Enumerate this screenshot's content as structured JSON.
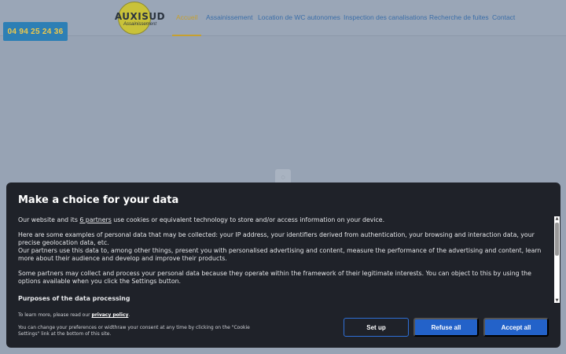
{
  "header": {
    "logo": {
      "name": "AUXISUD",
      "tagline": "Assainissement"
    },
    "nav": [
      {
        "label": "Accueil",
        "active": true
      },
      {
        "label": "Assainissement",
        "active": false
      },
      {
        "label": "Location de WC autonomes",
        "active": false
      },
      {
        "label": "Inspection des canalisations",
        "active": false
      },
      {
        "label": "Recherche de fuites",
        "active": false
      },
      {
        "label": "Contact",
        "active": false
      }
    ],
    "phone": "04 94 25 24 36",
    "colors": {
      "nav_link": "#3b6ea8",
      "nav_active": "#c7a02f",
      "phone_bg": "#2d7fb5",
      "phone_text": "#f0c94a"
    }
  },
  "loader": {
    "icon": "spinner-icon"
  },
  "consent": {
    "title": "Make a choice for your data",
    "intro_prefix": "Our website and its ",
    "partners_link": "6 partners",
    "intro_suffix": " use cookies or equivalent technology to store and/or access information on your device.",
    "paragraph_examples": "Here are some examples of personal data that may be collected: your IP address, your identifiers derived from authentication, your browsing and interaction data, your precise geolocation data, etc.",
    "paragraph_partners": "Our partners use this data to, among other things, present you with personalised advertising and content, measure the performance of the advertising and content, learn more about their audience and develop and improve their products.",
    "paragraph_legitimate": "Some partners may collect and process your personal data because they operate within the framework of their legitimate interests. You can object to this by using the options available when you click the Settings button.",
    "purposes_heading": "Purposes of the data processing",
    "learn_more_prefix": "To learn more, please read our ",
    "privacy_link": "privacy policy",
    "learn_more_suffix": ".",
    "change_text": "You can change your preferences or widthraw your consent at any time by clicking on the \"Cookie Settings\" link at the bottom of this site.",
    "buttons": {
      "setup": "Set up",
      "refuse": "Refuse all",
      "accept": "Accept all"
    },
    "colors": {
      "background": "#1f2229",
      "button_primary": "#2362c9",
      "button_outline": "#2f6fd6"
    }
  }
}
